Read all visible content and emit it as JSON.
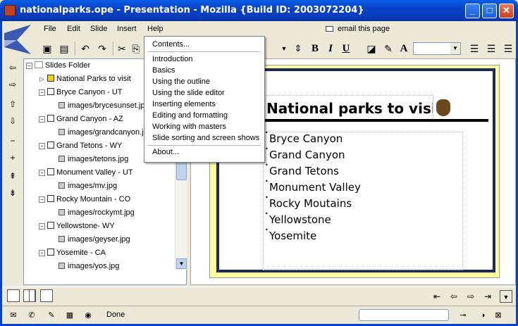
{
  "window": {
    "title": "nationalparks.ope - Presentation - Mozilla {Build ID: 2003072204}",
    "minimize": "_",
    "maximize": "□",
    "close": "✕"
  },
  "menubar": {
    "items": [
      "File",
      "Edit",
      "Slide",
      "Insert",
      "Help"
    ],
    "email_label": "email this page"
  },
  "toolbar": {
    "bold": "B",
    "italic": "I",
    "underline": "U"
  },
  "help_menu": {
    "items": [
      "Contents...",
      "Introduction",
      "Basics",
      "Using the outline",
      "Using the slide editor",
      "Inserting elements",
      "Editing and formatting",
      "Working with masters",
      "Slide sorting and screen shows",
      "About..."
    ]
  },
  "tree": {
    "root": "Slides Folder",
    "nodes": [
      {
        "label": "National Parks to visit",
        "kind": "folder"
      },
      {
        "label": "Bryce Canyon - UT",
        "kind": "slide"
      },
      {
        "label": "images/brycesunset.jpg",
        "kind": "image"
      },
      {
        "label": "Grand Canyon - AZ",
        "kind": "slide"
      },
      {
        "label": "images/grandcanyon.jpg",
        "kind": "image"
      },
      {
        "label": "Grand Tetons - WY",
        "kind": "slide"
      },
      {
        "label": "images/tetons.jpg",
        "kind": "image"
      },
      {
        "label": "Monument Valley - UT",
        "kind": "slide"
      },
      {
        "label": "images/mv.jpg",
        "kind": "image"
      },
      {
        "label": "Rocky Mountain - CO",
        "kind": "slide"
      },
      {
        "label": "images/rockymt.jpg",
        "kind": "image"
      },
      {
        "label": "Yellowstone- WY",
        "kind": "slide"
      },
      {
        "label": "images/geyser.jpg",
        "kind": "image"
      },
      {
        "label": "Yosemite - CA",
        "kind": "slide"
      },
      {
        "label": "images/yos.jpg",
        "kind": "image"
      }
    ]
  },
  "slide": {
    "title": "National parks to visit",
    "bullets": [
      "Bryce Canyon",
      "Grand Canyon",
      "Grand Tetons",
      "Monument Valley",
      "Rocky Moutains",
      "Yellowstone",
      "Yosemite"
    ]
  },
  "status": {
    "text": "Done"
  },
  "colors": {
    "titlebar": "#0842c8",
    "slide_border": "#1a2a5a",
    "slide_background": "#ffffa0"
  }
}
